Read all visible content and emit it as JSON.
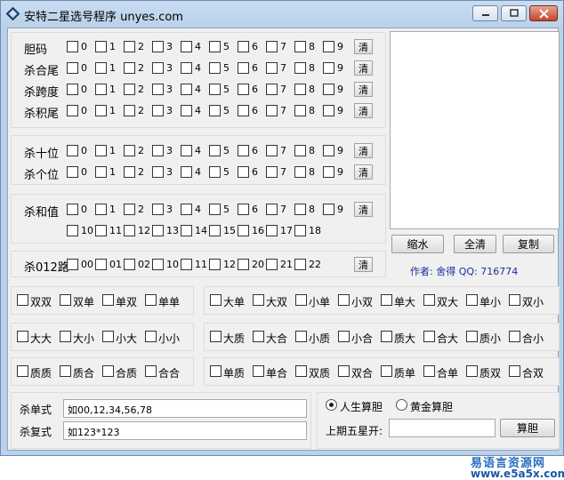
{
  "window": {
    "title": "安特二星选号程序 unyes.com"
  },
  "digits": [
    "0",
    "1",
    "2",
    "3",
    "4",
    "5",
    "6",
    "7",
    "8",
    "9"
  ],
  "clear_label": "清",
  "group1_rows": [
    "胆码",
    "杀合尾",
    "杀跨度",
    "杀积尾"
  ],
  "group2_rows": [
    "杀十位",
    "杀个位"
  ],
  "sum_label": "杀和值",
  "sum_values_row2": [
    "10",
    "11",
    "12",
    "13",
    "14",
    "15",
    "16",
    "17",
    "18"
  ],
  "road_label": "杀012路",
  "road_values": [
    "00",
    "01",
    "02",
    "10",
    "11",
    "12",
    "20",
    "21",
    "22"
  ],
  "combo_left": [
    [
      "双双",
      "双单",
      "单双",
      "单单"
    ],
    [
      "大大",
      "大小",
      "小大",
      "小小"
    ],
    [
      "质质",
      "质合",
      "合质",
      "合合"
    ]
  ],
  "combo_right": [
    [
      "大单",
      "大双",
      "小单",
      "小双",
      "单大",
      "双大",
      "单小",
      "双小"
    ],
    [
      "大质",
      "大合",
      "小质",
      "小合",
      "质大",
      "合大",
      "质小",
      "合小"
    ],
    [
      "单质",
      "单合",
      "双质",
      "双合",
      "质单",
      "合单",
      "质双",
      "合双"
    ]
  ],
  "buttons": {
    "shrink": "缩水",
    "clear_all": "全清",
    "copy": "复制",
    "calc": "算胆"
  },
  "author_text": "作者: 舍得   QQ: 716774",
  "kill_single": {
    "label": "杀单式",
    "value": "如00,12,34,56,78"
  },
  "kill_multi": {
    "label": "杀复式",
    "value": "如123*123"
  },
  "radios": {
    "life_label": "人生算胆",
    "gold_label": "黄金算胆",
    "selected": "life"
  },
  "prev_open": {
    "label": "上期五星开:",
    "value": ""
  },
  "watermark": {
    "line1": "易语言资源网",
    "line2": "www.e5a5x.com"
  }
}
